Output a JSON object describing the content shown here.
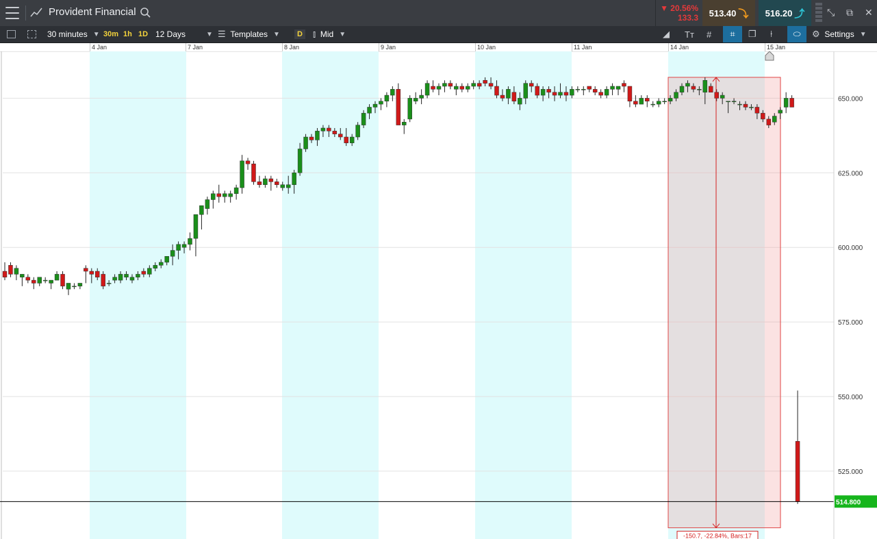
{
  "header": {
    "title": "Provident Financial",
    "change_pct": "20.56%",
    "change_abs": "133.3",
    "sell_price": "513.40",
    "buy_price": "516.20"
  },
  "toolbar": {
    "interval": "30 minutes",
    "quick": [
      "30m",
      "1h",
      "1D"
    ],
    "range": "12 Days",
    "templates": "Templates",
    "d_label": "D",
    "price_type": "Mid",
    "settings": "Settings"
  },
  "chart_data": {
    "type": "candlestick",
    "x_labels": [
      "4 Jan",
      "7 Jan",
      "8 Jan",
      "9 Jan",
      "10 Jan",
      "11 Jan",
      "14 Jan",
      "15 Jan"
    ],
    "y_ticks": [
      "650.000",
      "625.000",
      "600.000",
      "575.000",
      "550.000",
      "525.000"
    ],
    "y_range": [
      505,
      668
    ],
    "current_price": "514.800",
    "measure_label": "-150.7, -22.84%, Bars:17",
    "colors": {
      "up": "#1a8f1a",
      "down": "#d01919",
      "shade": "#dffbfc",
      "price_tag": "#16b51c"
    },
    "candles": [
      [
        592,
        595,
        589,
        590
      ],
      [
        594,
        595,
        590,
        591
      ],
      [
        591,
        594,
        589,
        593
      ],
      [
        590,
        591,
        587,
        591
      ],
      [
        590,
        591,
        588,
        589
      ],
      [
        589,
        590,
        586,
        588
      ],
      [
        588,
        590,
        587,
        590
      ],
      [
        589,
        590,
        588,
        589
      ],
      [
        588,
        589,
        586,
        589
      ],
      [
        589,
        592,
        589,
        591
      ],
      [
        591,
        592,
        586,
        587
      ],
      [
        586,
        588,
        584,
        588
      ],
      [
        587,
        588,
        586,
        587
      ],
      [
        587,
        588,
        586,
        588
      ],
      [
        593,
        594,
        588,
        592
      ],
      [
        592,
        593,
        588,
        591
      ],
      [
        592,
        593,
        589,
        590
      ],
      [
        591,
        592,
        586,
        587
      ],
      [
        588,
        589,
        587,
        588
      ],
      [
        589,
        591,
        588,
        590
      ],
      [
        589,
        592,
        588,
        591
      ],
      [
        590,
        592,
        589,
        591
      ],
      [
        589,
        591,
        588,
        590
      ],
      [
        590,
        592,
        589,
        591
      ],
      [
        592,
        593,
        590,
        591
      ],
      [
        591,
        594,
        590,
        593
      ],
      [
        593,
        595,
        592,
        594
      ],
      [
        594,
        596,
        593,
        595
      ],
      [
        595,
        597,
        594,
        597
      ],
      [
        597,
        601,
        594,
        599
      ],
      [
        599,
        602,
        596,
        601
      ],
      [
        600,
        602,
        598,
        601
      ],
      [
        601,
        605,
        599,
        603
      ],
      [
        603,
        608,
        597,
        611
      ],
      [
        611,
        614,
        606,
        614
      ],
      [
        613,
        617,
        611,
        616
      ],
      [
        616,
        619,
        613,
        618
      ],
      [
        618,
        621,
        615,
        617
      ],
      [
        617,
        619,
        615,
        618
      ],
      [
        617,
        619,
        615,
        618
      ],
      [
        618,
        621,
        616,
        620
      ],
      [
        620,
        631,
        618,
        629
      ],
      [
        629,
        630,
        626,
        628
      ],
      [
        628,
        629,
        621,
        622
      ],
      [
        622,
        624,
        620,
        621
      ],
      [
        621,
        624,
        620,
        623
      ],
      [
        623,
        624,
        619,
        622
      ],
      [
        622,
        623,
        620,
        621
      ],
      [
        620,
        622,
        619,
        621
      ],
      [
        620,
        624,
        618,
        621
      ],
      [
        621,
        626,
        618,
        625
      ],
      [
        625,
        635,
        624,
        633
      ],
      [
        633,
        638,
        632,
        637
      ],
      [
        637,
        638,
        635,
        636
      ],
      [
        636,
        640,
        634,
        639
      ],
      [
        639,
        641,
        637,
        640
      ],
      [
        640,
        641,
        637,
        639
      ],
      [
        639,
        640,
        637,
        638
      ],
      [
        638,
        640,
        636,
        637
      ],
      [
        637,
        640,
        634,
        635
      ],
      [
        635,
        638,
        634,
        637
      ],
      [
        637,
        642,
        636,
        641
      ],
      [
        641,
        646,
        640,
        645
      ],
      [
        645,
        648,
        643,
        647
      ],
      [
        647,
        649,
        645,
        648
      ],
      [
        648,
        650,
        646,
        649
      ],
      [
        649,
        652,
        647,
        651
      ],
      [
        651,
        654,
        649,
        653
      ],
      [
        653,
        655,
        642,
        641
      ],
      [
        641,
        643,
        638,
        642
      ],
      [
        643,
        651,
        642,
        650
      ],
      [
        649,
        652,
        648,
        650
      ],
      [
        650,
        653,
        648,
        651
      ],
      [
        651,
        656,
        650,
        655
      ],
      [
        654,
        656,
        652,
        653
      ],
      [
        653,
        655,
        651,
        654
      ],
      [
        654,
        656,
        652,
        655
      ],
      [
        655,
        656,
        653,
        654
      ],
      [
        653,
        655,
        651,
        654
      ],
      [
        654,
        655,
        652,
        653
      ],
      [
        653,
        655,
        652,
        654
      ],
      [
        654,
        656,
        653,
        655
      ],
      [
        655,
        656,
        653,
        654
      ],
      [
        656,
        657,
        654,
        655
      ],
      [
        655,
        657,
        653,
        654
      ],
      [
        654,
        656,
        650,
        651
      ],
      [
        651,
        653,
        649,
        650
      ],
      [
        650,
        654,
        648,
        653
      ],
      [
        652,
        654,
        648,
        649
      ],
      [
        648,
        652,
        646,
        650
      ],
      [
        650,
        656,
        648,
        655
      ],
      [
        655,
        656,
        652,
        654
      ],
      [
        654,
        655,
        650,
        651
      ],
      [
        651,
        654,
        649,
        653
      ],
      [
        653,
        654,
        650,
        652
      ],
      [
        652,
        654,
        649,
        651
      ],
      [
        651,
        655,
        650,
        652
      ],
      [
        652,
        654,
        649,
        651
      ],
      [
        651,
        654,
        650,
        653
      ],
      [
        653,
        654,
        652,
        653
      ],
      [
        653,
        654,
        651,
        653
      ],
      [
        654,
        654,
        652,
        653
      ],
      [
        653,
        654,
        651,
        652
      ],
      [
        652,
        653,
        650,
        651
      ],
      [
        651,
        654,
        650,
        653
      ],
      [
        653,
        655,
        651,
        654
      ],
      [
        653,
        654,
        651,
        654
      ],
      [
        655,
        656,
        652,
        654
      ],
      [
        654,
        654,
        647,
        649
      ],
      [
        649,
        651,
        647,
        648
      ],
      [
        648,
        651,
        648,
        650
      ],
      [
        650,
        651,
        647,
        649
      ],
      [
        648,
        649,
        647,
        648
      ],
      [
        648,
        650,
        647,
        649
      ],
      [
        649,
        650,
        648,
        649
      ],
      [
        649,
        651,
        648,
        650
      ],
      [
        650,
        653,
        649,
        652
      ],
      [
        652,
        655,
        651,
        654
      ],
      [
        654,
        656,
        652,
        655
      ],
      [
        654,
        655,
        652,
        653
      ],
      [
        653,
        654,
        651,
        653
      ],
      [
        652,
        657,
        648,
        656
      ],
      [
        654,
        655,
        652,
        652
      ],
      [
        652,
        653,
        649,
        650
      ],
      [
        650,
        652,
        648,
        651
      ],
      [
        649,
        649,
        645,
        649
      ],
      [
        649,
        650,
        648,
        649
      ],
      [
        648,
        649,
        646,
        648
      ],
      [
        648,
        649,
        646,
        647
      ],
      [
        647,
        648,
        646,
        647
      ],
      [
        647,
        648,
        643,
        645
      ],
      [
        645,
        646,
        642,
        643
      ],
      [
        643,
        644,
        640,
        641
      ],
      [
        642,
        645,
        641,
        644
      ],
      [
        645,
        647,
        643,
        646
      ],
      [
        647,
        652,
        645,
        650
      ],
      [
        650,
        651,
        647,
        647
      ],
      [
        535,
        552,
        514,
        514.8
      ]
    ]
  }
}
